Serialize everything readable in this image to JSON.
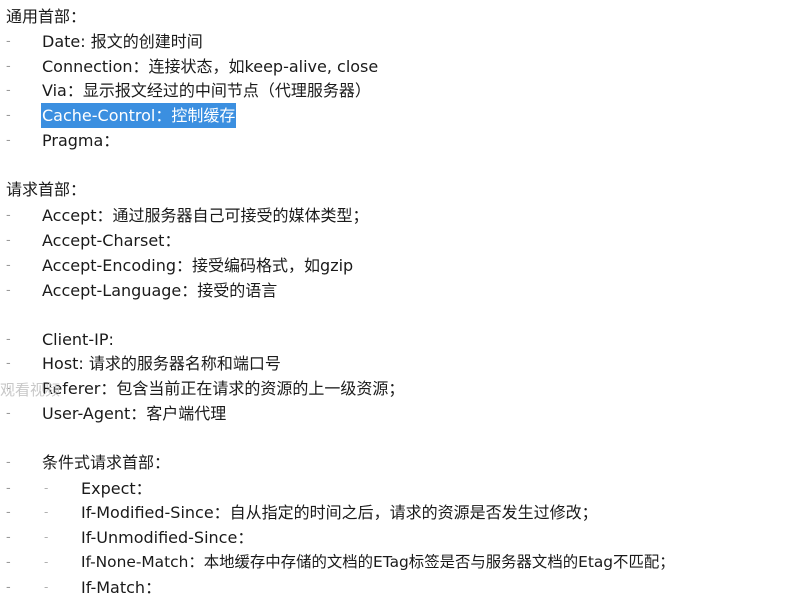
{
  "sections": {
    "general_headers": {
      "title": "通用首部：",
      "items": [
        "Date: 报文的创建时间",
        "Connection：连接状态，如keep-alive, close",
        "Via：显示报文经过的中间节点（代理服务器）",
        "Cache-Control：控制缓存",
        "Pragma："
      ]
    },
    "request_headers": {
      "title": "请求首部：",
      "items": [
        "Accept：通过服务器自己可接受的媒体类型；",
        "Accept-Charset：",
        "Accept-Encoding：接受编码格式，如gzip",
        "Accept-Language：接受的语言",
        "Client-IP:",
        "Host: 请求的服务器名称和端口号",
        "Referer：包含当前正在请求的资源的上一级资源；",
        "User-Agent：客户端代理"
      ]
    },
    "conditional_headers": {
      "title": "条件式请求首部：",
      "items": [
        "Expect：",
        "If-Modified-Since：自从指定的时间之后，请求的资源是否发生过修改；",
        "If-Unmodified-Since：",
        "If-None-Match：本地缓存中存储的文档的ETag标签是否与服务器文档的Etag不匹配；",
        "If-Match："
      ]
    }
  },
  "bullet_char": "-",
  "watermark": "观看视频"
}
